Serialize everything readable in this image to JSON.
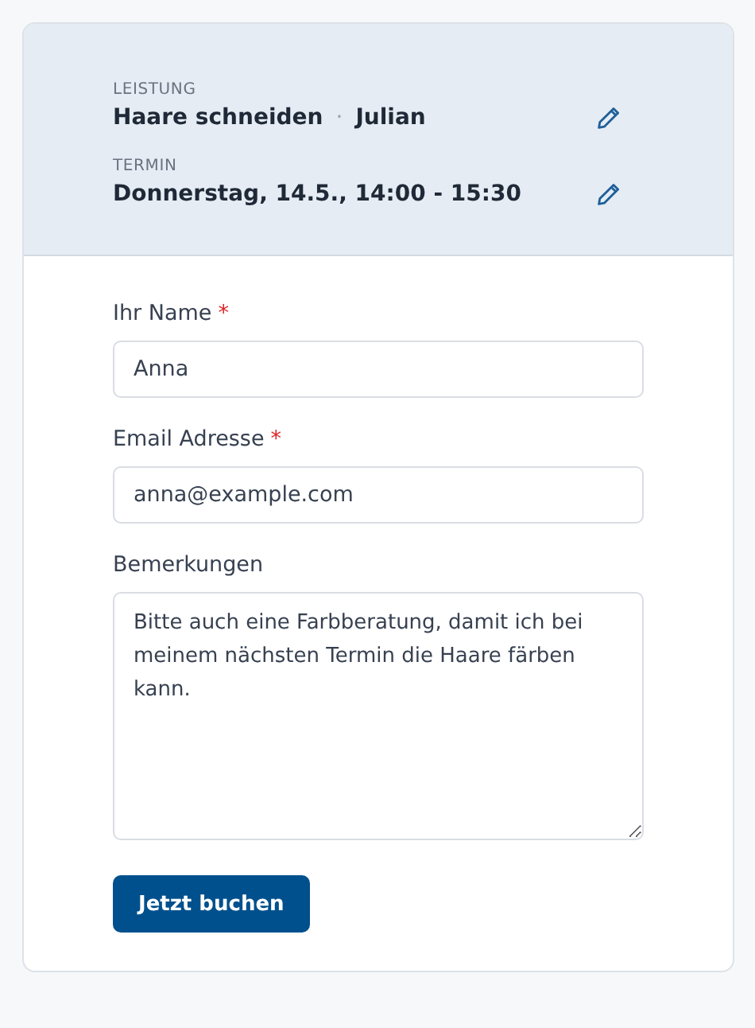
{
  "summary": [
    {
      "label": "LEISTUNG",
      "value": "Haare schneiden",
      "separator": "·",
      "detail": "Julian"
    },
    {
      "label": "TERMIN",
      "value": "Donnerstag, 14.5., 14:00 - 15:30"
    }
  ],
  "fields": [
    {
      "kind": "input",
      "label": "Ihr Name",
      "required_mark": "*",
      "value": "Anna"
    },
    {
      "kind": "input",
      "label": "Email Adresse",
      "required_mark": "*",
      "value": "anna@example.com"
    },
    {
      "kind": "textarea",
      "label": "Bemerkungen",
      "value": "Bitte auch eine Farbberatung, damit ich bei meinem nächsten Termin die Haare färben kann."
    }
  ],
  "submit": {
    "label": "Jetzt buchen"
  }
}
